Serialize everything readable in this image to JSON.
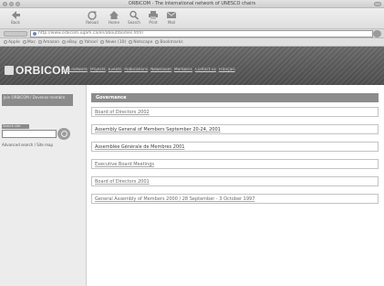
{
  "window": {
    "title": "ORBICOM · The international network of UNESCO chairs"
  },
  "toolbar": {
    "buttons": [
      {
        "label": "Back",
        "icon": "back-arrow-icon"
      },
      {
        "label": "Reload",
        "icon": "reload-icon"
      },
      {
        "label": "Home",
        "icon": "home-icon"
      },
      {
        "label": "Search",
        "icon": "search-icon"
      },
      {
        "label": "Print",
        "icon": "print-icon"
      },
      {
        "label": "Mail",
        "icon": "mail-icon"
      }
    ]
  },
  "location": {
    "url": "http://www.orbicom.uqam.ca/en/about/bodies.html"
  },
  "bookmarks": [
    "Apple",
    "Mac",
    "Amazon",
    "eBay",
    "Yahoo!",
    "News (10)",
    "Netscape",
    "Bookmarks"
  ],
  "site": {
    "logo": "ORBICOM",
    "nav": [
      "The network",
      "Projects",
      "Events",
      "Publications",
      "Newsroom",
      "Members",
      "Contact us",
      "Français"
    ]
  },
  "sidebar": {
    "box_text": "Join ORBICOM / Devenez membre",
    "search_label": "Search site",
    "link": "Advanced search / Site map"
  },
  "content": {
    "header": "Governance",
    "items": [
      "Board of Directors 2002",
      "Assembly General of Members September 20-24, 2001",
      "Assemblée Générale de Membres 2001",
      "Executive Board Meetings",
      "Board of Directors 2001",
      "General Assembly of Members 2000 / 28 September - 3 October 1997"
    ]
  }
}
